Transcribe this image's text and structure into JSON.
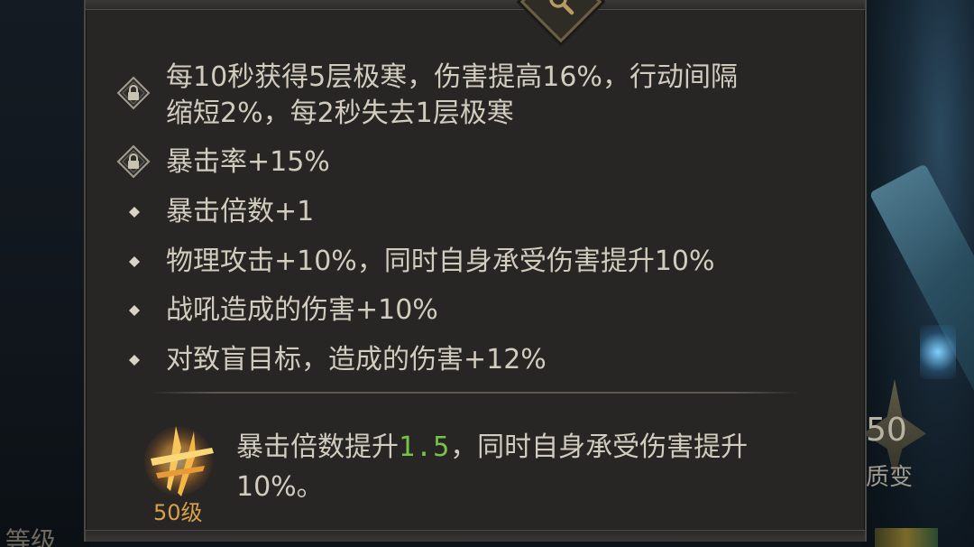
{
  "background": {
    "badge_level": "50",
    "badge_label": "质变",
    "corner_text": "等级"
  },
  "tooltip": {
    "icons": {
      "top": "magnifier-icon",
      "locked_marker": "lock-diamond-icon",
      "bullet_marker": "diamond-bullet-icon",
      "skill": "claw-slash-icon"
    },
    "effects": [
      {
        "marker": "lock",
        "line1": "每10秒获得5层极寒，伤害提高16%，行动间隔",
        "line2": "缩短2%，每2秒失去1层极寒"
      },
      {
        "marker": "lock",
        "line1": "暴击率+15%"
      },
      {
        "marker": "dot",
        "line1": "暴击倍数+1"
      },
      {
        "marker": "dot",
        "line1": "物理攻击+10%，同时自身承受伤害提升10%"
      },
      {
        "marker": "dot",
        "line1": "战吼造成的伤害+10%"
      },
      {
        "marker": "dot",
        "line1": "对致盲目标，造成的伤害+12%"
      }
    ],
    "skill": {
      "level": "50级",
      "text_before": "暴击倍数提升",
      "highlight": "1.5",
      "text_after": "，同时自身承受伤害提升",
      "line2": "10%。"
    }
  },
  "colors": {
    "text": "#d1ccbe",
    "highlight": "#77c24a",
    "level": "#d9a04c",
    "panel": "#272625"
  }
}
